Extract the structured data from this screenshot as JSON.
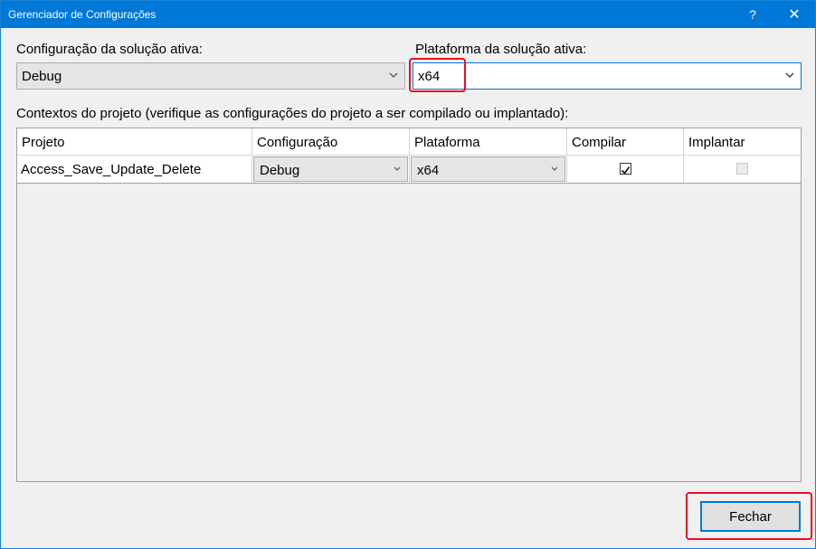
{
  "window": {
    "title": "Gerenciador de Configurações",
    "help_label": "?",
    "close_label": "✕"
  },
  "active_config": {
    "label": "Configuração da solução ativa:",
    "value": "Debug"
  },
  "active_platform": {
    "label": "Plataforma da solução ativa:",
    "value": "x64"
  },
  "contexts_label": "Contextos do projeto (verifique as configurações do projeto a ser compilado ou implantado):",
  "grid": {
    "headers": [
      "Projeto",
      "Configuração",
      "Plataforma",
      "Compilar",
      "Implantar"
    ],
    "rows": [
      {
        "project": "Access_Save_Update_Delete",
        "configuration": "Debug",
        "platform": "x64",
        "build": true,
        "deploy": false
      }
    ]
  },
  "close_button_label": "Fechar",
  "colors": {
    "titlebar": "#0078d7",
    "highlight": "#e81123",
    "dialog_bg": "#f0f0f0"
  }
}
